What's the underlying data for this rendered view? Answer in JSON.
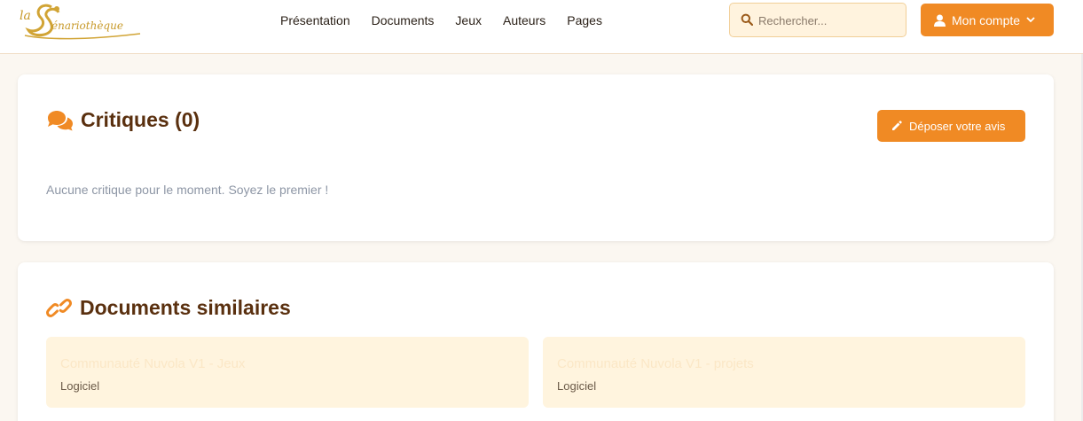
{
  "header": {
    "logo_text": "la Scénariothèque",
    "nav": [
      "Présentation",
      "Documents",
      "Jeux",
      "Auteurs",
      "Pages"
    ],
    "search_placeholder": "Rechercher...",
    "account_label": "Mon compte"
  },
  "critiques": {
    "title": "Critiques (0)",
    "button_label": "Déposer votre avis",
    "empty_message": "Aucune critique pour le moment. Soyez le premier !"
  },
  "similar": {
    "title": "Documents similaires",
    "items": [
      {
        "title": "Communauté Nuvola V1 - Jeux",
        "type": "Logiciel"
      },
      {
        "title": "Communauté Nuvola V1 - projets",
        "type": "Logiciel"
      }
    ]
  },
  "colors": {
    "accent": "#f08a24",
    "title_brown": "#5a300f",
    "doc_card_bg": "#fff4de"
  },
  "icons": [
    "search-icon",
    "user-icon",
    "chevron-down-icon",
    "comments-icon",
    "pencil-icon",
    "link-icon"
  ]
}
